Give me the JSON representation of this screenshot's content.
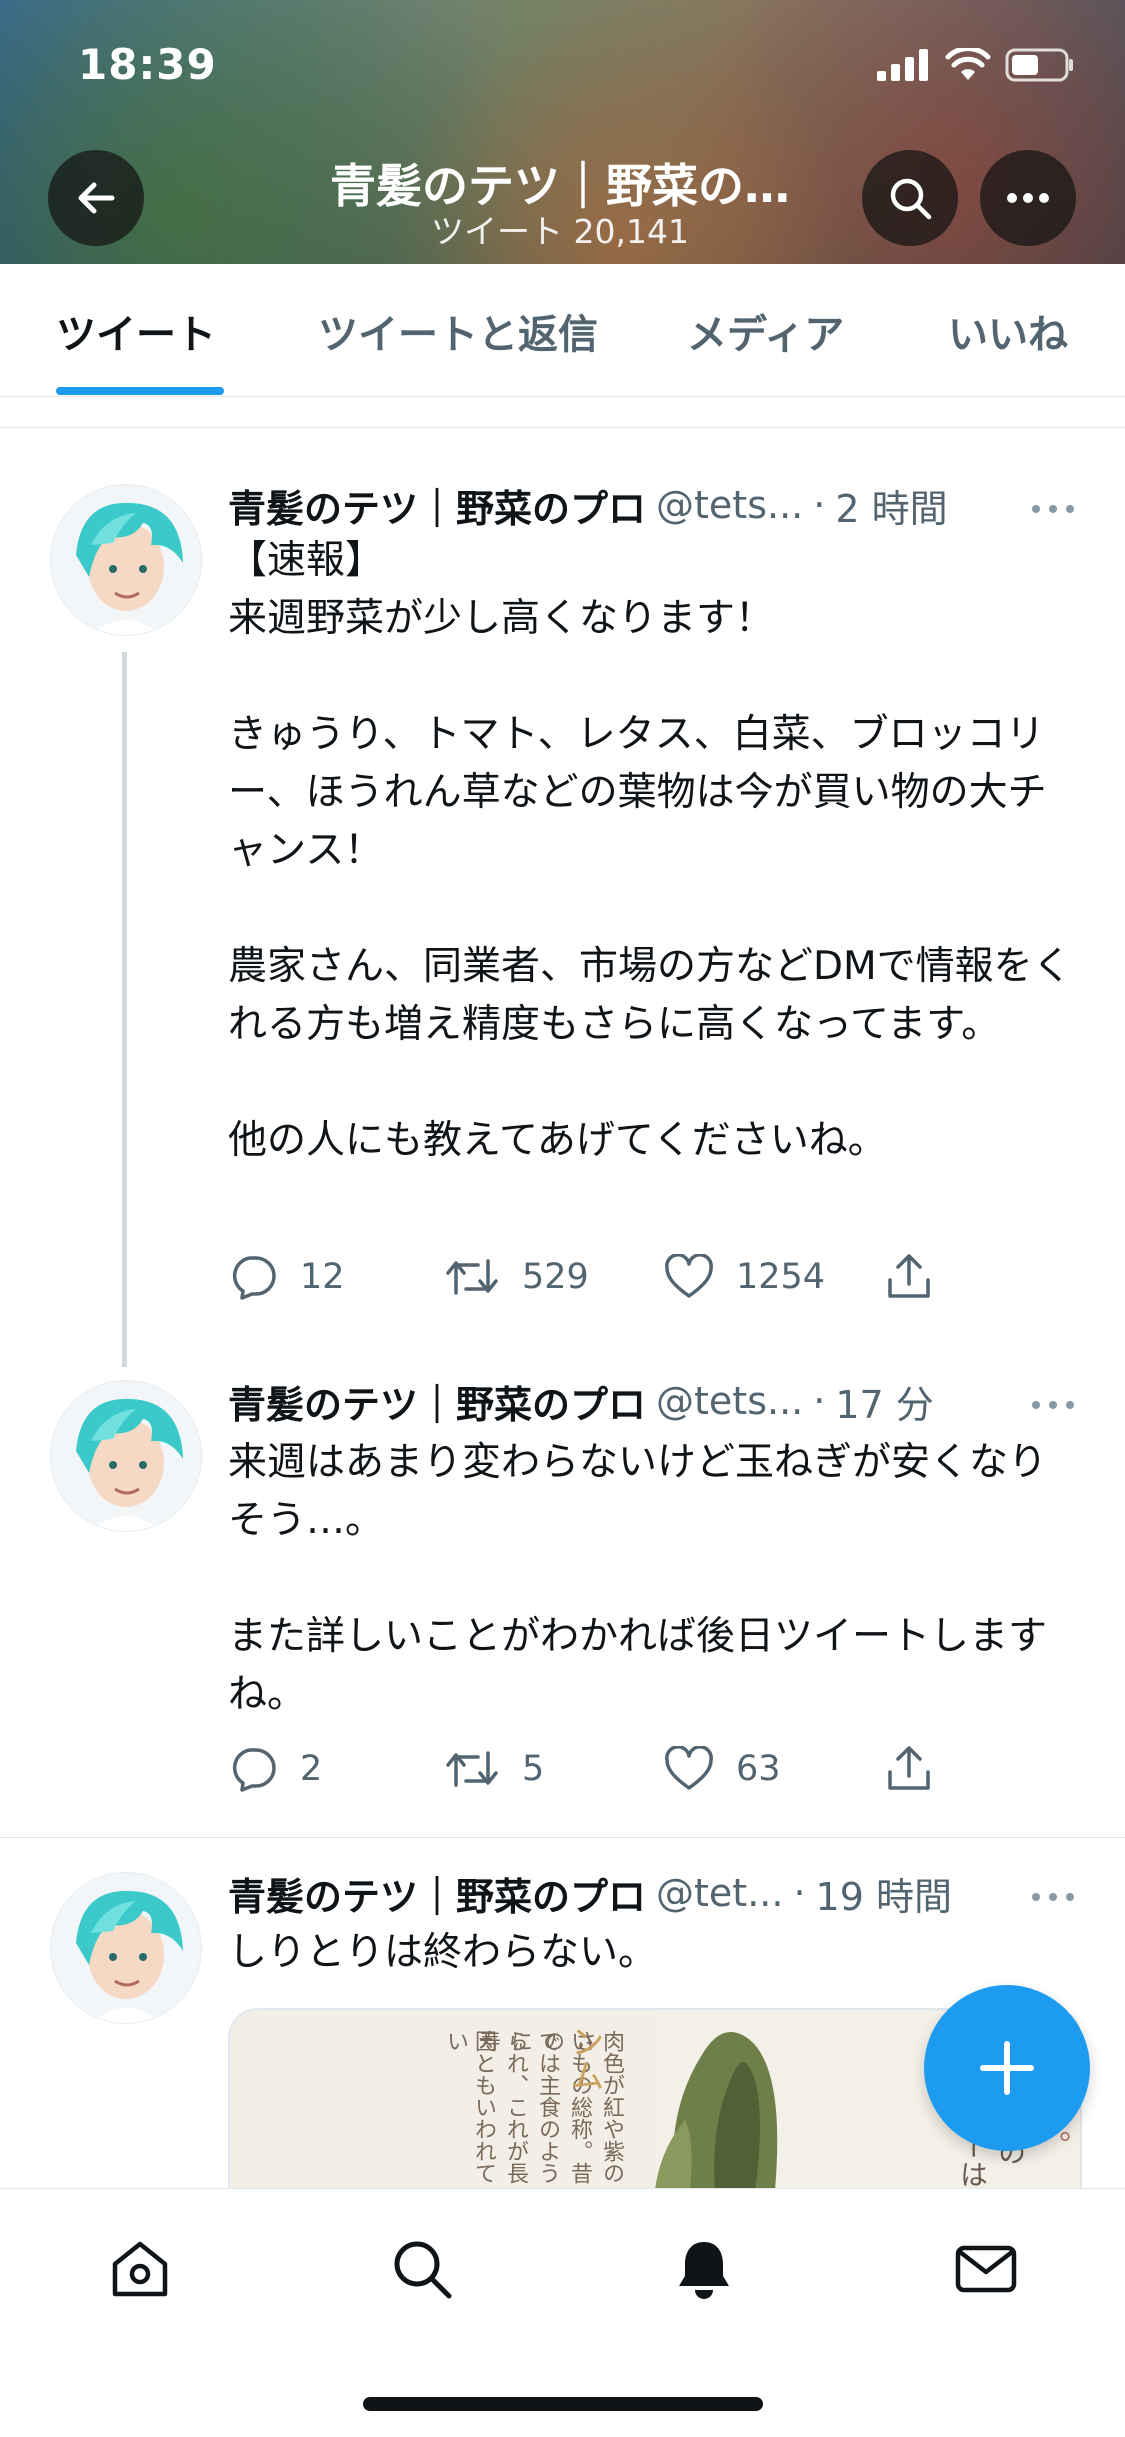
{
  "status_bar": {
    "time": "18:39"
  },
  "header": {
    "title": "青髪のテツ｜野菜の…",
    "tweet_count": "ツイート 20,141"
  },
  "tabs": [
    {
      "label": "ツイート",
      "active": true
    },
    {
      "label": "ツイートと返信"
    },
    {
      "label": "メディア"
    },
    {
      "label": "いいね"
    }
  ],
  "tweets": [
    {
      "name": "青髪のテツ｜野菜のプロ",
      "handle": "@tets...",
      "dot": "·",
      "time": "2 時間",
      "text": "【速報】\n来週野菜が少し高くなります！\n\nきゅうり、トマト、レタス、白菜、ブロッコリー、ほうれん草などの葉物は今が買い物の大チャンス！\n\n農家さん、同業者、市場の方などDMで情報をくれる方も増え精度もさらに高くなってます。\n\n他の人にも教えてあげてくださいね。",
      "replies": "12",
      "retweets": "529",
      "likes": "1254"
    },
    {
      "name": "青髪のテツ｜野菜のプロ",
      "handle": "@tets...",
      "dot": "·",
      "time": "17 分",
      "text": "来週はあまり変わらないけど玉ねぎが安くなりそう…。\n\nまた詳しいことがわかれば後日ツイートしますね。",
      "replies": "2",
      "retweets": "5",
      "likes": "63"
    },
    {
      "name": "青髪のテツ｜野菜のプロ",
      "handle": "@tet...",
      "dot": "·",
      "time": "19 時間",
      "text": "しりとりは終わらない。",
      "media_text_left": [
        "肉色が紅や紫のさ",
        "いもの総称。昔の",
        "では主食のように",
        "られ、これが長寿",
        "因ともいわれてい"
      ],
      "media_text_mid": "ンム",
      "media_text_right": [
        "のスーネーは",
        "特の",
        "な。"
      ]
    }
  ],
  "fab": {
    "icon": "plus-icon"
  },
  "bottom_nav": [
    {
      "icon": "home-icon"
    },
    {
      "icon": "search-icon"
    },
    {
      "icon": "bell-icon"
    },
    {
      "icon": "mail-icon"
    }
  ],
  "colors": {
    "accent": "#1d9bf0",
    "text": "#0f1419",
    "secondary": "#536471"
  }
}
